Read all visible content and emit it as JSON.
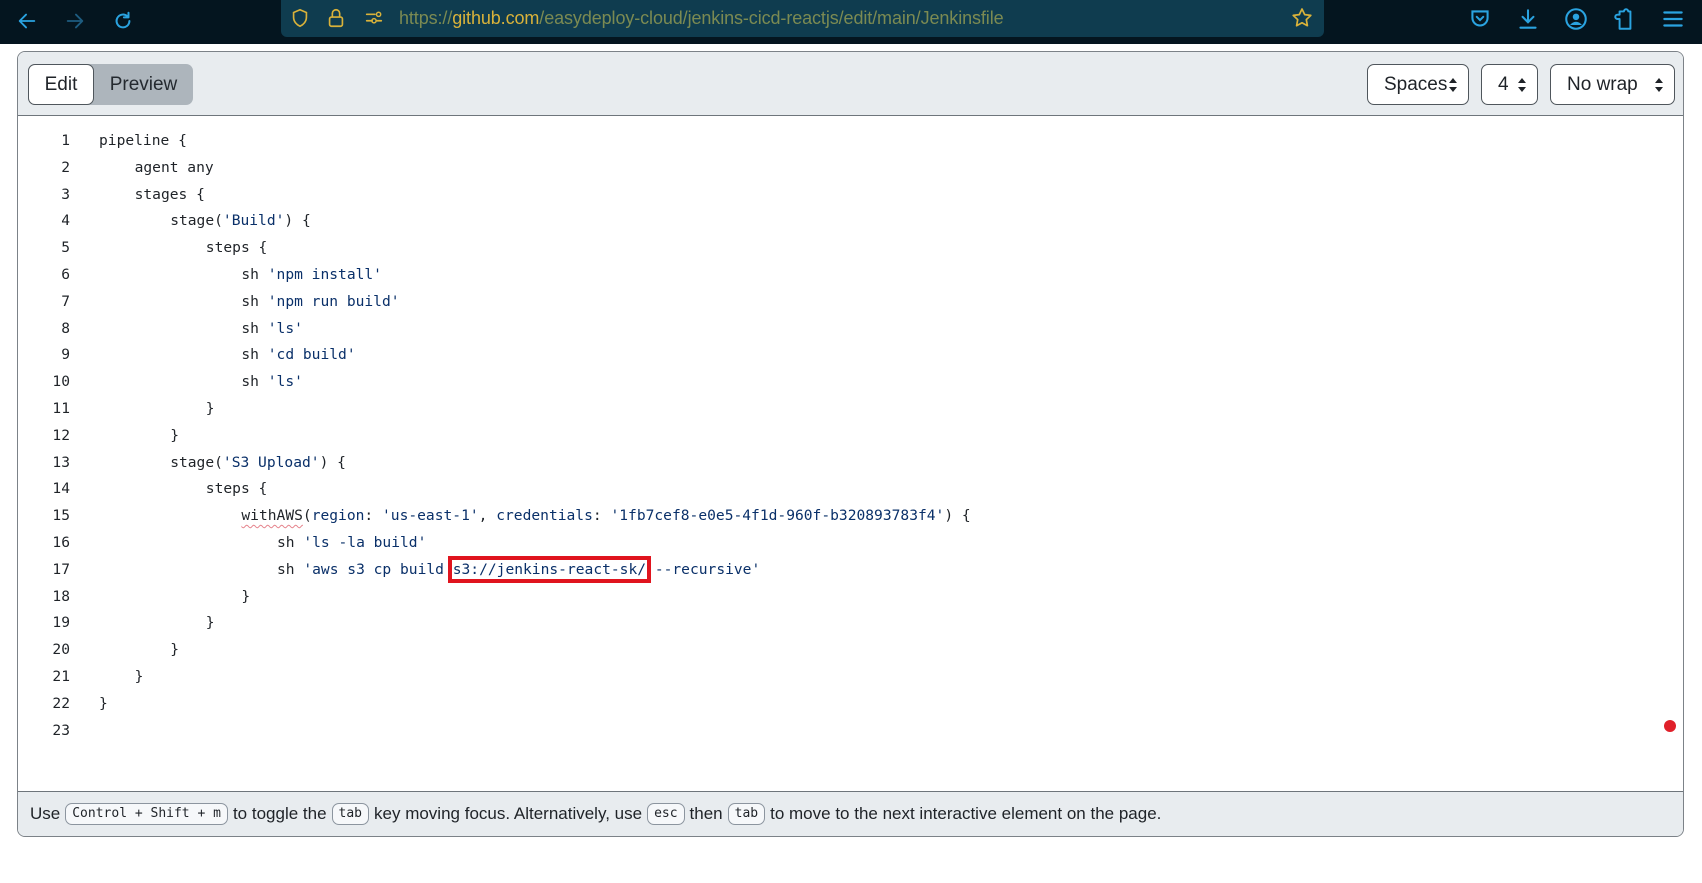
{
  "browser": {
    "url_scheme": "https://",
    "url_host": "github.com",
    "url_path": "/easydeploy-cloud/jenkins-cicd-reactjs/edit/main/Jenkinsfile",
    "icons": {
      "back": "back-arrow-icon",
      "forward": "forward-arrow-icon",
      "reload": "reload-icon",
      "shield": "tracking-protection-shield-icon",
      "lock": "lock-icon",
      "permissions": "site-permissions-icon",
      "bookmark": "bookmark-star-icon",
      "pocket": "pocket-icon",
      "downloads": "download-icon",
      "account": "account-icon",
      "extensions": "extensions-icon",
      "menu": "hamburger-menu-icon"
    }
  },
  "editor": {
    "tabs": [
      {
        "label": "Edit",
        "active": true
      },
      {
        "label": "Preview",
        "active": false
      }
    ],
    "indent_mode": "Spaces",
    "indent_size": "4",
    "wrap_mode": "No wrap",
    "highlight_color": "#e0141e",
    "lines": [
      {
        "n": "1",
        "indent": 0,
        "parts": [
          {
            "t": "pipeline {",
            "c": "plain"
          }
        ]
      },
      {
        "n": "2",
        "indent": 1,
        "parts": [
          {
            "t": "agent any",
            "c": "plain"
          }
        ]
      },
      {
        "n": "3",
        "indent": 1,
        "parts": [
          {
            "t": "stages {",
            "c": "plain"
          }
        ]
      },
      {
        "n": "4",
        "indent": 2,
        "parts": [
          {
            "t": "stage(",
            "c": "plain"
          },
          {
            "t": "'Build'",
            "c": "str"
          },
          {
            "t": ") {",
            "c": "plain"
          }
        ]
      },
      {
        "n": "5",
        "indent": 3,
        "parts": [
          {
            "t": "steps {",
            "c": "plain"
          }
        ]
      },
      {
        "n": "6",
        "indent": 4,
        "parts": [
          {
            "t": "sh ",
            "c": "plain"
          },
          {
            "t": "'npm install'",
            "c": "str"
          }
        ]
      },
      {
        "n": "7",
        "indent": 4,
        "parts": [
          {
            "t": "sh ",
            "c": "plain"
          },
          {
            "t": "'npm run build'",
            "c": "str"
          }
        ]
      },
      {
        "n": "8",
        "indent": 4,
        "parts": [
          {
            "t": "sh ",
            "c": "plain"
          },
          {
            "t": "'ls'",
            "c": "str"
          }
        ]
      },
      {
        "n": "9",
        "indent": 4,
        "parts": [
          {
            "t": "sh ",
            "c": "plain"
          },
          {
            "t": "'cd build'",
            "c": "str"
          }
        ]
      },
      {
        "n": "10",
        "indent": 4,
        "parts": [
          {
            "t": "sh ",
            "c": "plain"
          },
          {
            "t": "'ls'",
            "c": "str"
          }
        ]
      },
      {
        "n": "11",
        "indent": 3,
        "parts": [
          {
            "t": "}",
            "c": "plain"
          }
        ]
      },
      {
        "n": "12",
        "indent": 2,
        "parts": [
          {
            "t": "}",
            "c": "plain"
          }
        ]
      },
      {
        "n": "13",
        "indent": 2,
        "parts": [
          {
            "t": "stage(",
            "c": "plain"
          },
          {
            "t": "'S3 Upload'",
            "c": "str"
          },
          {
            "t": ") {",
            "c": "plain"
          }
        ]
      },
      {
        "n": "14",
        "indent": 3,
        "parts": [
          {
            "t": "steps {",
            "c": "plain"
          }
        ]
      },
      {
        "n": "15",
        "indent": 4,
        "parts": [
          {
            "t": "withAWS",
            "c": "err"
          },
          {
            "t": "(",
            "c": "plain"
          },
          {
            "t": "region",
            "c": "kw"
          },
          {
            "t": ": ",
            "c": "plain"
          },
          {
            "t": "'us-east-1'",
            "c": "str"
          },
          {
            "t": ", ",
            "c": "plain"
          },
          {
            "t": "credentials",
            "c": "kw"
          },
          {
            "t": ": ",
            "c": "plain"
          },
          {
            "t": "'1fb7cef8-e0e5-4f1d-960f-b320893783f4'",
            "c": "str"
          },
          {
            "t": ") {",
            "c": "plain"
          }
        ]
      },
      {
        "n": "16",
        "indent": 5,
        "parts": [
          {
            "t": "sh ",
            "c": "plain"
          },
          {
            "t": "'ls -la build'",
            "c": "str"
          }
        ]
      },
      {
        "n": "17",
        "indent": 5,
        "parts": [
          {
            "t": "sh ",
            "c": "plain"
          },
          {
            "t": "'aws s3 cp build ",
            "c": "str"
          },
          {
            "t": "s3://jenkins-react-sk/",
            "c": "str-hl"
          },
          {
            "t": " --recursive'",
            "c": "str"
          }
        ]
      },
      {
        "n": "18",
        "indent": 4,
        "parts": [
          {
            "t": "}",
            "c": "plain"
          }
        ]
      },
      {
        "n": "19",
        "indent": 3,
        "parts": [
          {
            "t": "}",
            "c": "plain"
          }
        ]
      },
      {
        "n": "20",
        "indent": 2,
        "parts": [
          {
            "t": "}",
            "c": "plain"
          }
        ]
      },
      {
        "n": "21",
        "indent": 1,
        "parts": [
          {
            "t": "}",
            "c": "plain"
          }
        ]
      },
      {
        "n": "22",
        "indent": 0,
        "parts": [
          {
            "t": "}",
            "c": "plain"
          }
        ]
      },
      {
        "n": "23",
        "indent": 0,
        "parts": []
      }
    ],
    "footer": {
      "t1": "Use",
      "k1": "Control + Shift + m",
      "t2": "to toggle the",
      "k2": "tab",
      "t3": "key moving focus. Alternatively, use",
      "k3": "esc",
      "t4": "then",
      "k4": "tab",
      "t5": "to move to the next interactive element on the page."
    }
  }
}
